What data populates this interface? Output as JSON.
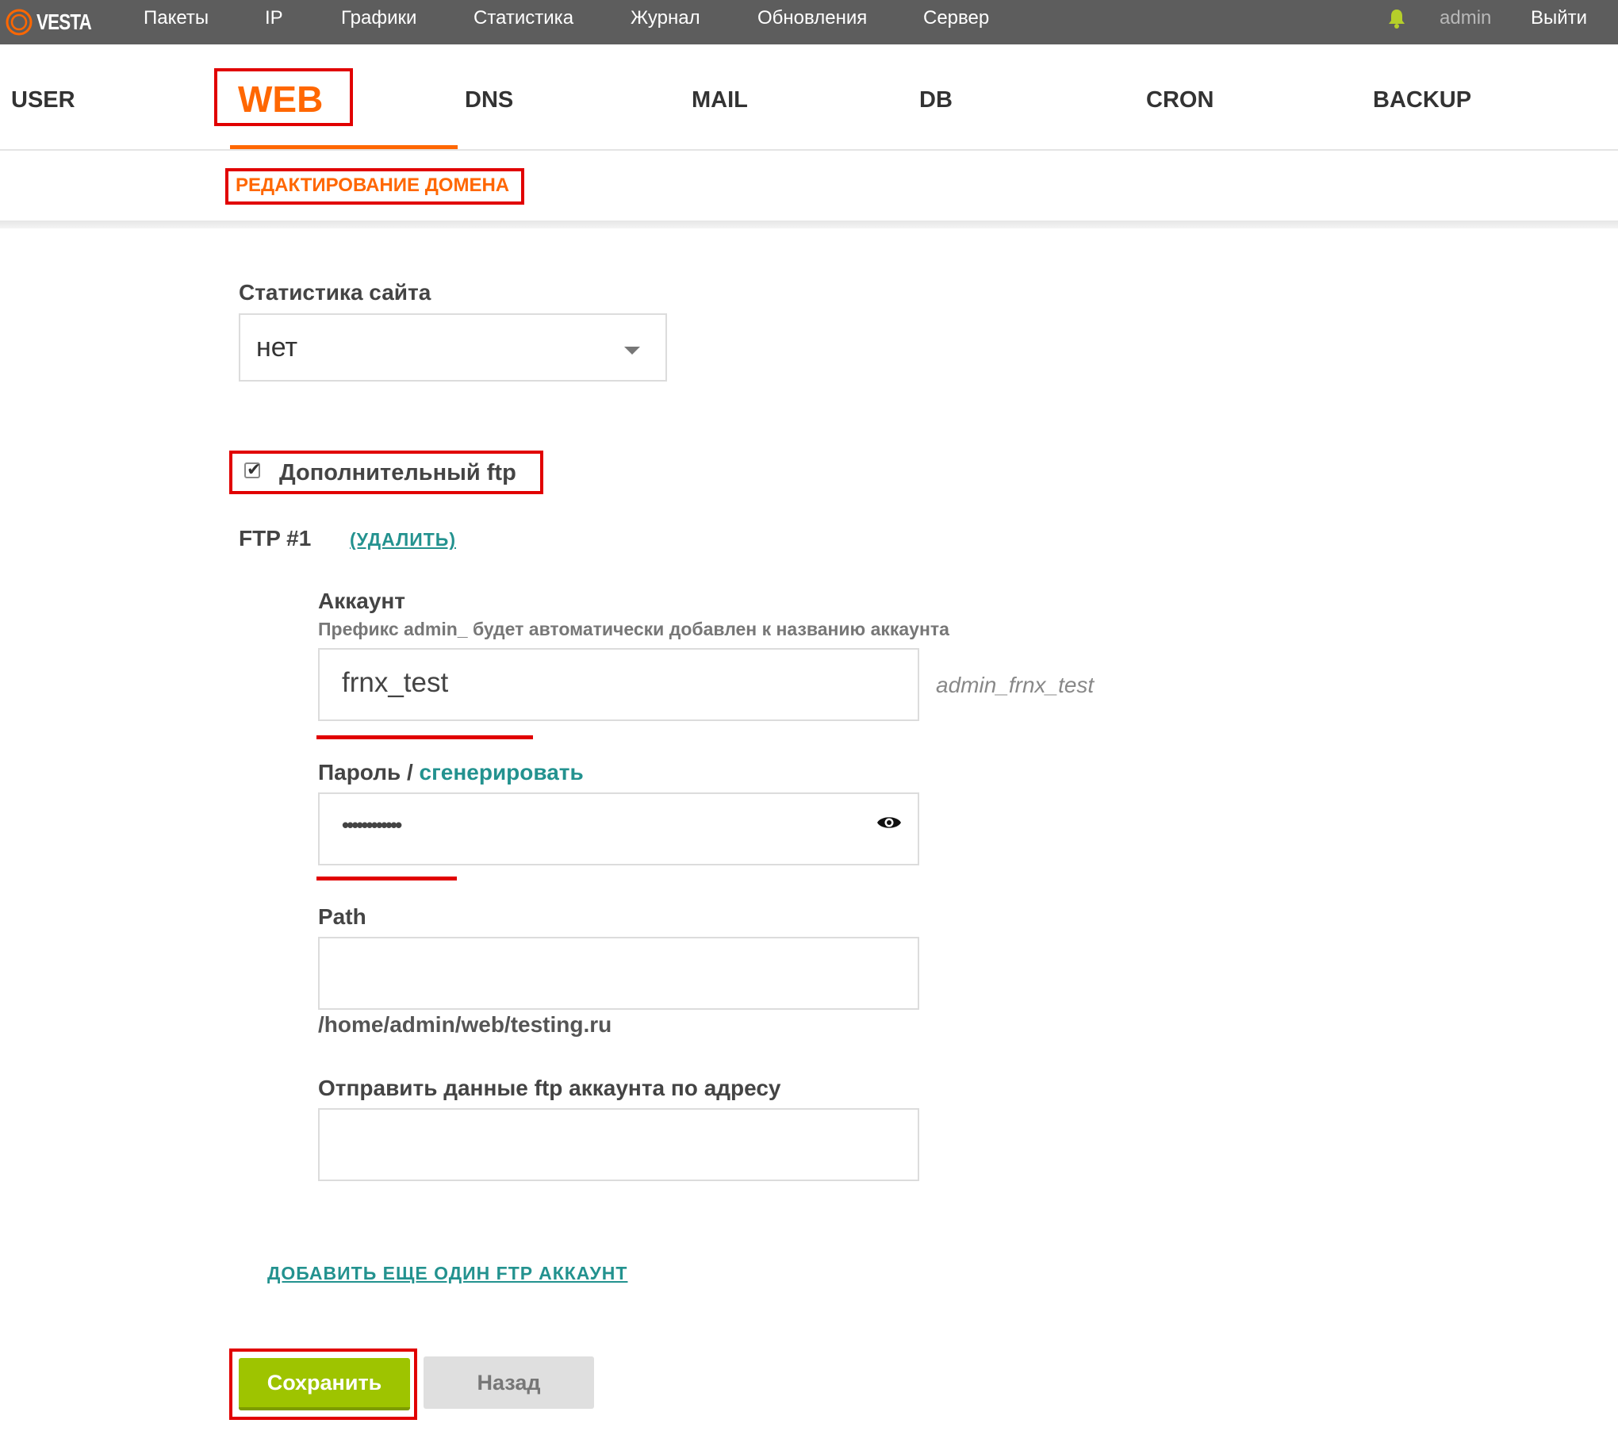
{
  "topbar": {
    "logo_text": "VESTA",
    "nav": [
      "Пакеты",
      "IP",
      "Графики",
      "Статистика",
      "Журнал",
      "Обновления",
      "Сервер"
    ],
    "user": "admin",
    "logout": "Выйти"
  },
  "tabs": [
    "USER",
    "WEB",
    "DNS",
    "MAIL",
    "DB",
    "CRON",
    "BACKUP"
  ],
  "active_tab": "WEB",
  "subtab": "РЕДАКТИРОВАНИЕ ДОМЕНА",
  "form": {
    "stats_label": "Статистика сайта",
    "stats_value": "нет",
    "extra_ftp_label": "Дополнительный ftp",
    "extra_ftp_checked": true,
    "ftp_title": "FTP #1",
    "ftp_delete": "(УДАЛИТЬ)",
    "account_label": "Аккаунт",
    "account_hint": "Префикс admin_ будет автоматически добавлен к названию аккаунта",
    "account_value": "frnx_test",
    "account_full": "admin_frnx_test",
    "password_label": "Пароль / ",
    "password_generate": "сгенерировать",
    "password_value": "••••••••••••",
    "path_label": "Path",
    "path_value": "",
    "path_hint": "/home/admin/web/testing.ru",
    "email_label": "Отправить данные ftp аккаунта по адресу",
    "email_value": "",
    "add_ftp": "ДОБАВИТЬ ЕЩЕ ОДИН FTP АККАУНТ",
    "save": "Сохранить",
    "back": "Назад"
  },
  "colors": {
    "accent": "#ff6701",
    "highlight": "#e10000",
    "link": "#23928f",
    "save": "#9ec400",
    "topbar": "#5d5d5d"
  }
}
